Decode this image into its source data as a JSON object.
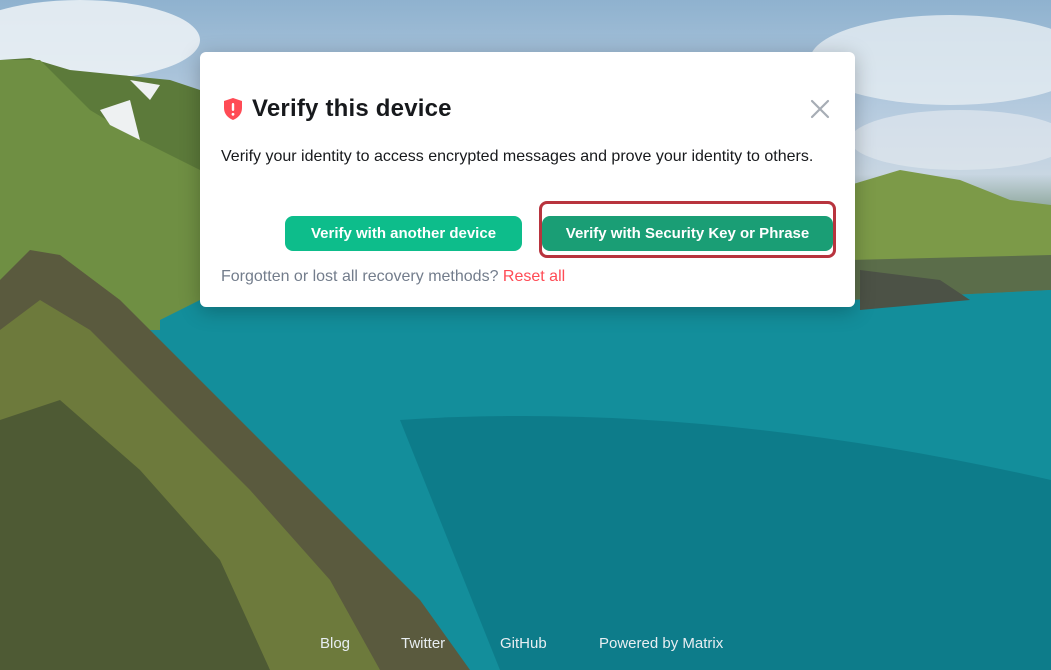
{
  "dialog": {
    "title": "Verify this device",
    "description": "Verify your identity to access encrypted messages and prove your identity to others.",
    "primary_button": "Verify with another device",
    "secondary_button": "Verify with Security Key or Phrase",
    "forgot_text": "Forgotten or lost all recovery methods?",
    "reset_link": "Reset all"
  },
  "footer_links": [
    "Blog",
    "Twitter",
    "GitHub",
    "Powered by Matrix"
  ],
  "icons": {
    "shield": "shield-warning-icon",
    "close": "close-icon"
  },
  "colors": {
    "accent": "#0dbd8b",
    "warning": "#ff4b55",
    "highlight_border": "#b8343e"
  }
}
